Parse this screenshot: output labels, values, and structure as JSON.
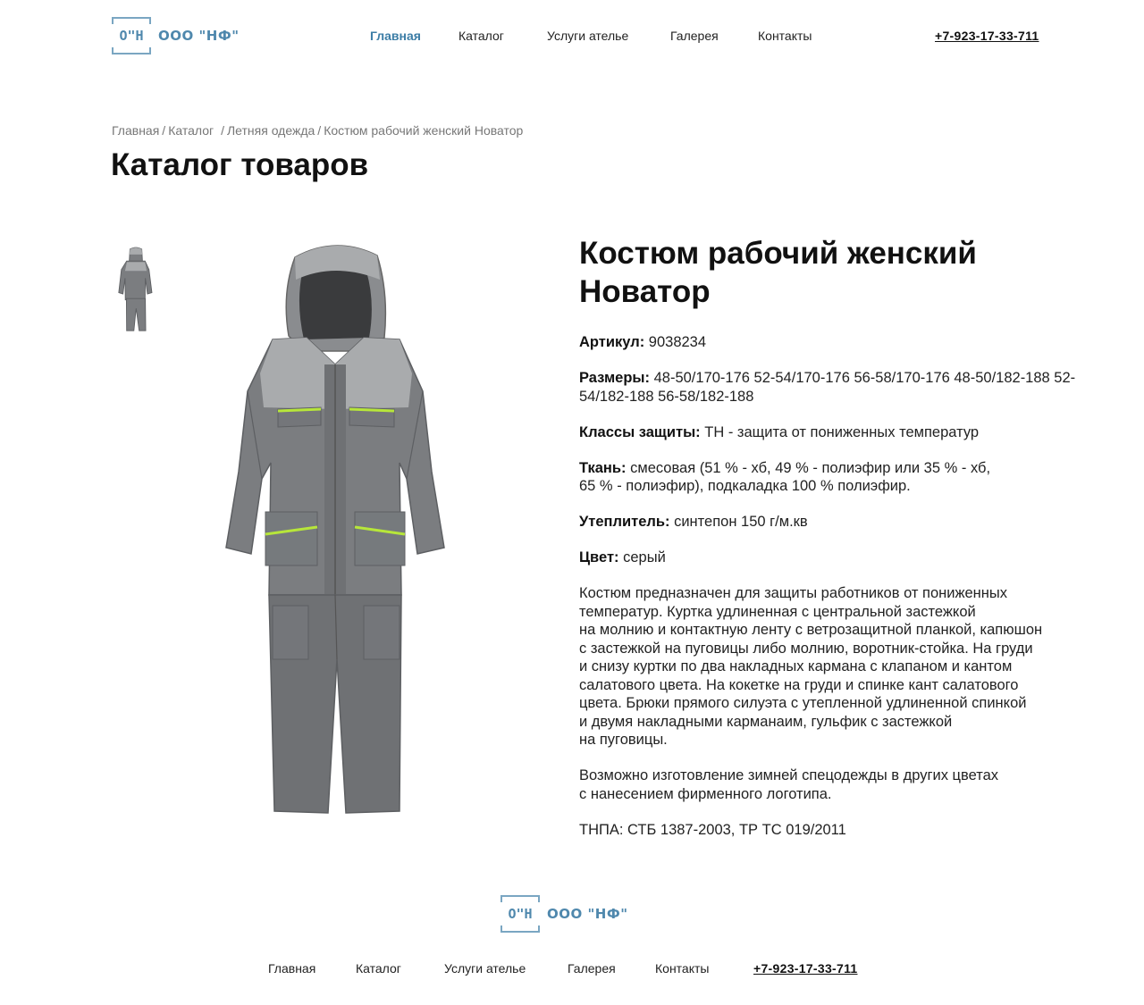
{
  "header": {
    "logo_mark": "O\"H",
    "logo_name": "ООО \"НФ\"",
    "nav": [
      "Главная",
      "Каталог",
      "Услуги ателье",
      "Галерея",
      "Контакты"
    ],
    "active_nav": "Главная",
    "phone": "+7-923-17-33-711"
  },
  "breadcrumb": {
    "items": [
      "Главная",
      "Каталог",
      "Летняя одежда",
      "Костюм рабочий женский Новатор"
    ],
    "separator": "/"
  },
  "page_title": "Каталог товаров",
  "product": {
    "title_line1": "Костюм рабочий женский",
    "title_line2": "Новатор",
    "article": {
      "label": "Артикул:",
      "value": "9038234"
    },
    "sizes": {
      "label": "Размеры:",
      "value": "48-50/170-176 52-54/170-176 56-58/170-176 48-50/182-188 52-54/182-188 56-58/182-188"
    },
    "protection": {
      "label": "Классы защиты:",
      "value": "ТН - защита от пониженных температур"
    },
    "fabric": {
      "label": "Ткань:",
      "value_line1": "смесовая (51 % - хб, 49 % - полиэфир или 35 % - хб,",
      "value_line2": "65 % - полиэфир), подкаладка 100 % полиэфир."
    },
    "insulation": {
      "label": "Утеплитель:",
      "value": "синтепон 150 г/м.кв"
    },
    "color": {
      "label": "Цвет:",
      "value": "серый"
    },
    "description_lines": [
      "Костюм предназначен для защиты работников от пониженных",
      "температур. Куртка удлиненная с центральной застежкой",
      "на молнию и контактную ленту с ветрозащитной планкой, капюшон",
      "с застежкой на пуговицы либо молнию, воротник-стойка. На груди",
      "и снизу куртки по два накладных кармана с клапаном и кантом",
      "салатового цвета. На кокетке на груди и спинке кант салатового",
      "цвета. Брюки прямого силуэта с утепленной удлиненной спинкой",
      "и двумя накладными карманаим, гульфик с застежкой",
      "на пуговицы."
    ],
    "extra_lines": [
      "Возможно изготовление зимней спецодежды в других цветах",
      "с нанесением фирменного логотипа."
    ],
    "standards": "ТНПА: СТБ 1387-2003, ТР ТС 019/2011"
  },
  "footer": {
    "logo_mark": "O\"H",
    "logo_name": "ООО \"НФ\"",
    "nav": [
      "Главная",
      "Каталог",
      "Услуги ателье",
      "Галерея",
      "Контакты"
    ],
    "phone": "+7-923-17-33-711"
  },
  "colors": {
    "accent": "#3c7da6",
    "logo": "#4f88ad",
    "suit_gray": "#7b7d80",
    "suit_light": "#a9abad",
    "trim_green": "#b7e63a"
  }
}
